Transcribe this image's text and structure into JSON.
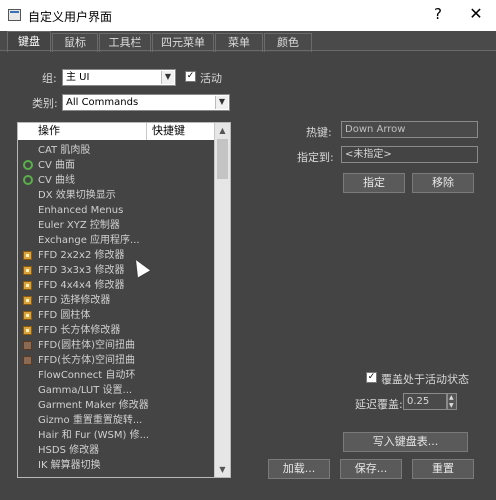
{
  "window": {
    "title": "自定义用户界面",
    "help": "?",
    "close": "✕"
  },
  "tabs": [
    {
      "label": "键盘",
      "active": true
    },
    {
      "label": "鼠标",
      "active": false
    },
    {
      "label": "工具栏",
      "active": false
    },
    {
      "label": "四元菜单",
      "active": false
    },
    {
      "label": "菜单",
      "active": false
    },
    {
      "label": "颜色",
      "active": false
    }
  ],
  "group": {
    "label": "组:",
    "value": "主 UI"
  },
  "active_checkbox": {
    "label": "活动",
    "checked": true
  },
  "category": {
    "label": "类别:",
    "value": "All Commands"
  },
  "list": {
    "col_action": "操作",
    "col_shortcut": "快捷键",
    "items": [
      {
        "text": "CAT 肌肉股",
        "icon": ""
      },
      {
        "text": "CV 曲面",
        "icon": "curve-icon"
      },
      {
        "text": "CV 曲线",
        "icon": "curve-icon"
      },
      {
        "text": "DX 效果切换显示",
        "icon": ""
      },
      {
        "text": "Enhanced Menus",
        "icon": ""
      },
      {
        "text": "Euler XYZ 控制器",
        "icon": ""
      },
      {
        "text": "Exchange 应用程序...",
        "icon": ""
      },
      {
        "text": "FFD 2x2x2 修改器",
        "icon": "ffd-icon"
      },
      {
        "text": "FFD 3x3x3 修改器",
        "icon": "ffd-icon"
      },
      {
        "text": "FFD 4x4x4 修改器",
        "icon": "ffd-icon"
      },
      {
        "text": "FFD 选择修改器",
        "icon": "ffd-icon"
      },
      {
        "text": "FFD 圆柱体",
        "icon": "ffd-icon"
      },
      {
        "text": "FFD 长方体修改器",
        "icon": "ffd-icon"
      },
      {
        "text": "FFD(圆柱体)空间扭曲",
        "icon": "ffd-space-icon"
      },
      {
        "text": "FFD(长方体)空间扭曲",
        "icon": "ffd-space-icon"
      },
      {
        "text": "FlowConnect 自动环",
        "icon": ""
      },
      {
        "text": "Gamma/LUT 设置...",
        "icon": ""
      },
      {
        "text": "Garment Maker 修改器",
        "icon": ""
      },
      {
        "text": "Gizmo 重置重置旋转...",
        "icon": ""
      },
      {
        "text": "Hair 和 Fur (WSM) 修...",
        "icon": ""
      },
      {
        "text": "HSDS 修改器",
        "icon": ""
      },
      {
        "text": "IK 解算器切换",
        "icon": ""
      }
    ]
  },
  "hotkey": {
    "label": "热键:",
    "value": "Down Arrow"
  },
  "assigned_to": {
    "label": "指定到:",
    "value": "<未指定>"
  },
  "buttons": {
    "assign": "指定",
    "remove": "移除",
    "write_keyboard": "写入键盘表...",
    "load": "加载...",
    "save": "保存...",
    "reset": "重置"
  },
  "override_checkbox": {
    "label": "覆盖处于活动状态",
    "checked": true
  },
  "delay_override": {
    "label": "延迟覆盖:",
    "value": "0.25"
  },
  "colors": {
    "background": "#444444",
    "titlebar": "#ffffff"
  }
}
